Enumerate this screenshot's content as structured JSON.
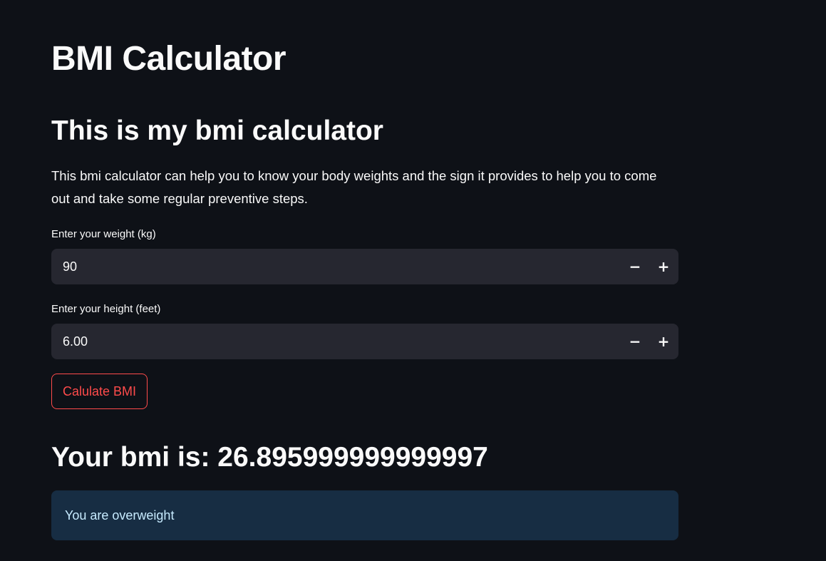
{
  "app": {
    "title": "BMI Calculator",
    "subtitle": "This is my bmi calculator",
    "description": "This bmi calculator can help you to know your body weights and the sign it provides to help you to come out and take some regular preventive steps."
  },
  "weight": {
    "label": "Enter your weight (kg)",
    "value": "90",
    "decrement_icon": "minus-icon",
    "increment_icon": "plus-icon",
    "decrement_glyph": "−",
    "increment_glyph": "+"
  },
  "height": {
    "label": "Enter your height (feet)",
    "value": "6.00",
    "decrement_icon": "minus-icon",
    "increment_icon": "plus-icon",
    "decrement_glyph": "−",
    "increment_glyph": "+"
  },
  "button": {
    "label": "Calulate BMI"
  },
  "result": {
    "text": "Your bmi is: 26.895999999999997"
  },
  "alert": {
    "text": "You are overweight"
  },
  "colors": {
    "background": "#0e1117",
    "input_background": "#262730",
    "accent": "#ff4b4b",
    "info_background": "#172d43",
    "info_text": "#c7ebff"
  }
}
